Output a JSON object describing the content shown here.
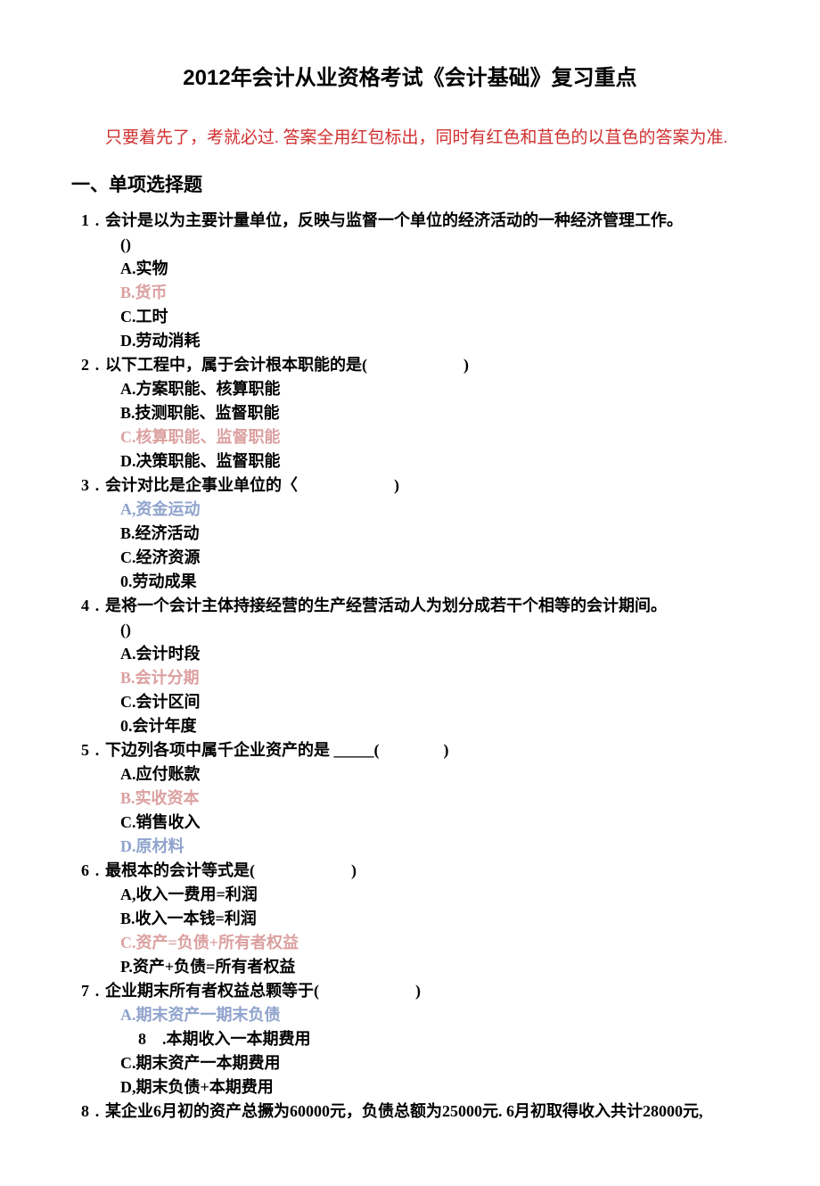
{
  "title": "2012年会计从业资格考试《会计基础》复习重点",
  "note": "只要着先了，考就必过. 答案全用红包标出，同时有红色和苴色的以苴色的答案为准.",
  "section": "一、单项选择题",
  "questions": [
    {
      "num": "1",
      "stem": "会计是以为主要计量单位，反映与监督一个单位的经济活动的一种经济管理工作。",
      "paren": "()",
      "options": [
        {
          "t": "A.实物",
          "c": ""
        },
        {
          "t": "B.货币",
          "c": "red"
        },
        {
          "t": "C.工时",
          "c": ""
        },
        {
          "t": "D.劳动消耗",
          "c": ""
        }
      ]
    },
    {
      "num": "2",
      "stem": "以下工程中，属于会计根本职能的是(　　　　　　)",
      "options": [
        {
          "t": "A.方案职能、核算职能",
          "c": ""
        },
        {
          "t": "B.技测职能、监督职能",
          "c": ""
        },
        {
          "t": "C.核算职能、监督职能",
          "c": "red"
        },
        {
          "t": "D.决策职能、监督职能",
          "c": ""
        }
      ]
    },
    {
      "num": "3",
      "stem": "会计对比是企事业单位的〈　　　　　　)",
      "options": [
        {
          "t": "A,资金运动",
          "c": "blue"
        },
        {
          "t": "B.经济活动",
          "c": ""
        },
        {
          "t": "C.经济资源",
          "c": ""
        },
        {
          "t": "0.劳动成果",
          "c": ""
        }
      ]
    },
    {
      "num": "4",
      "stem": "是将一个会计主体持接经营的生产经营活动人为划分成若干个相等的会计期间。",
      "paren": "()",
      "options": [
        {
          "t": "A.会计时段",
          "c": ""
        },
        {
          "t": "B.会计分期",
          "c": "red"
        },
        {
          "t": "C.会计区间",
          "c": ""
        },
        {
          "t": "0.会计年度",
          "c": ""
        }
      ]
    },
    {
      "num": "5",
      "stem": "下边列各项中属千企业资产的是 _____(　　　　)",
      "options": [
        {
          "t": "A.应付账款",
          "c": ""
        },
        {
          "t": "B.实收资本",
          "c": "red"
        },
        {
          "t": "C.销售收入",
          "c": ""
        },
        {
          "t": "D.原材料",
          "c": "blue"
        }
      ]
    },
    {
      "num": "6",
      "stem": "最根本的会计等式是(　　　　　　)",
      "options": [
        {
          "t": "A,收入一费用=利润",
          "c": ""
        },
        {
          "t": "B.收入一本钱=利润",
          "c": ""
        },
        {
          "t": "C.资产=负债+所有者权益",
          "c": "red"
        },
        {
          "t": "P.资产+负债=所有者权益",
          "c": ""
        }
      ]
    },
    {
      "num": "7",
      "stem": "企业期末所有者权益总颗等于(　　　　　　)",
      "options": [
        {
          "t": "A.期末资产一期末负债",
          "c": "blue"
        },
        {
          "t": "8　.本期收入一本期费用",
          "c": "",
          "sub": true
        },
        {
          "t": "C.期末资产一本期费用",
          "c": ""
        },
        {
          "t": "D,期末负债+本期费用",
          "c": ""
        }
      ]
    },
    {
      "num": "8",
      "stem": "某企业6月初的资产总撅为60000元，负债总额为25000元. 6月初取得收入共计28000元,"
    }
  ]
}
